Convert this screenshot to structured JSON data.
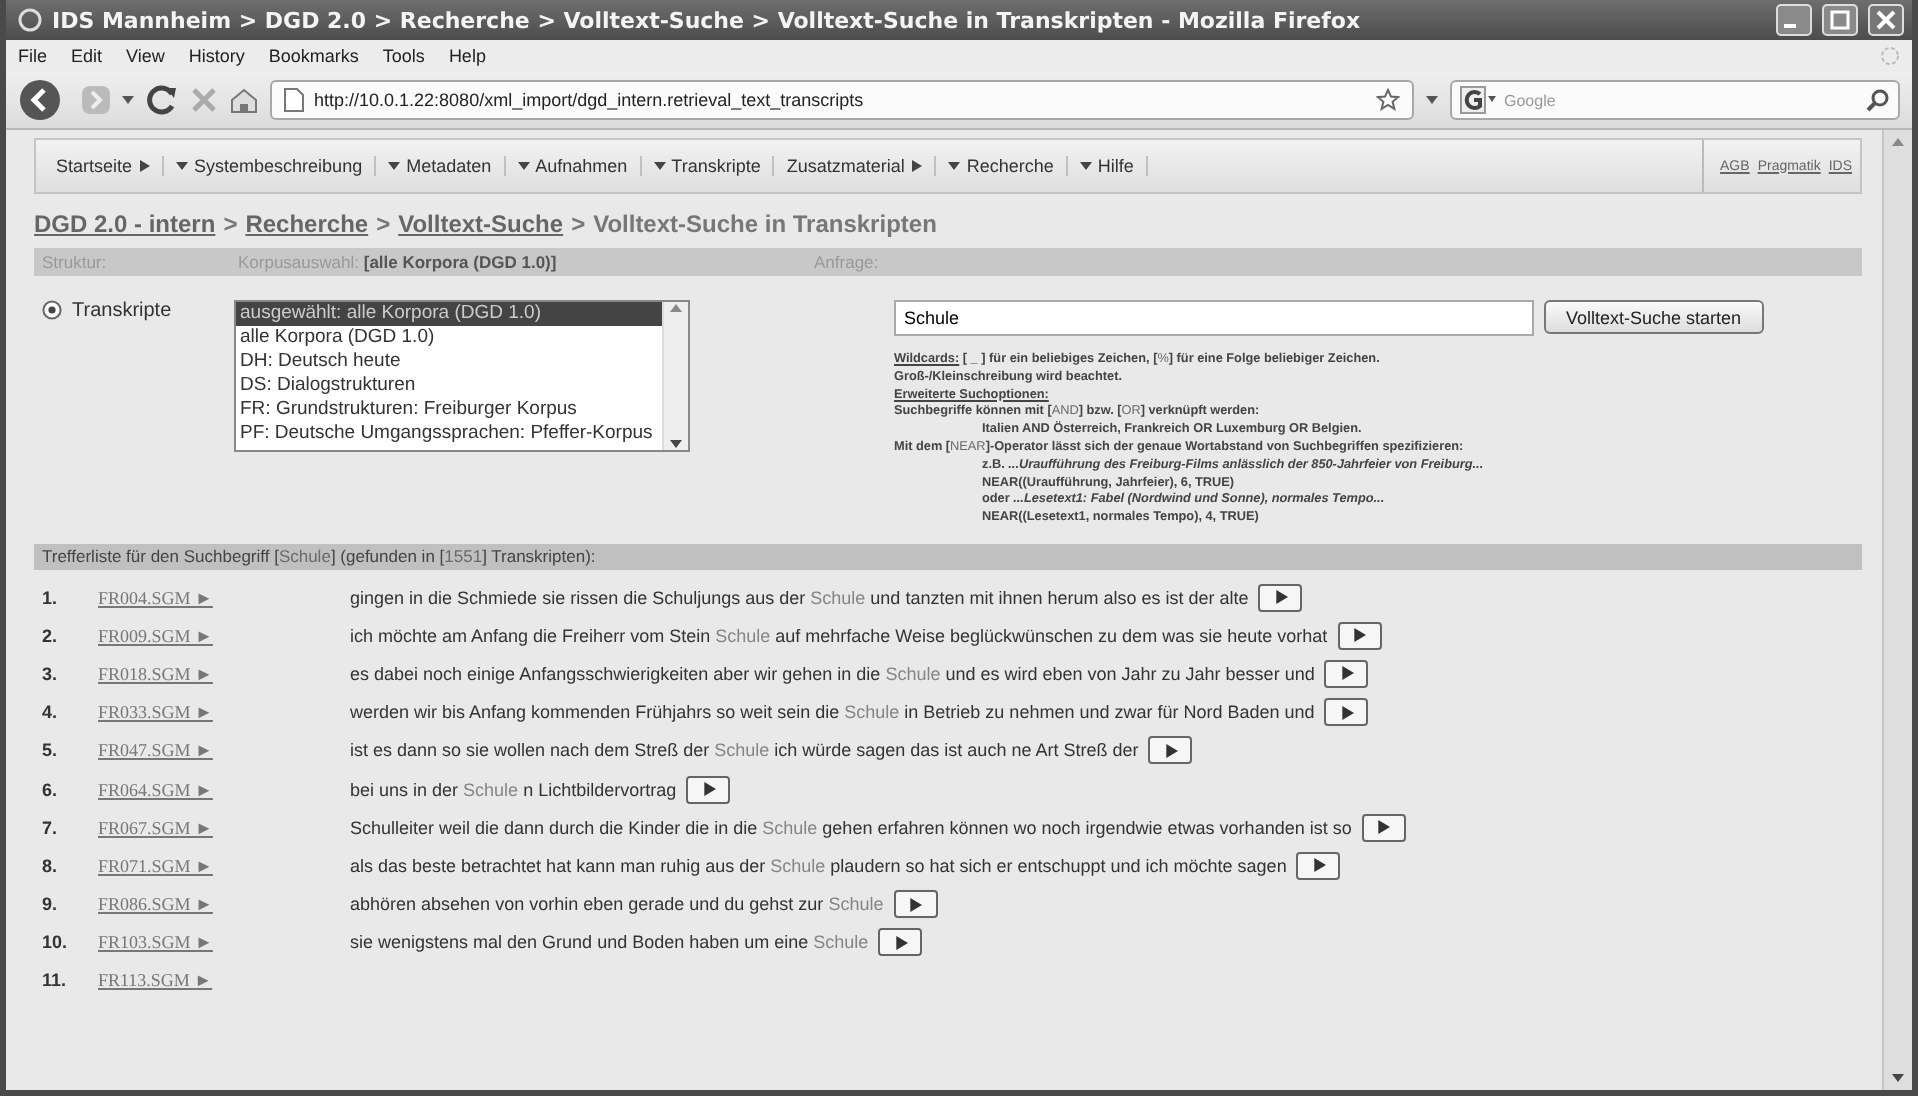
{
  "window": {
    "title": "IDS Mannheim > DGD 2.0 > Recherche > Volltext-Suche > Volltext-Suche in Transkripten - Mozilla Firefox"
  },
  "menu": [
    "File",
    "Edit",
    "View",
    "History",
    "Bookmarks",
    "Tools",
    "Help"
  ],
  "toolbar": {
    "url": "http://10.0.1.22:8080/xml_import/dgd_intern.retrieval_text_transcripts",
    "search_placeholder": "Google"
  },
  "site_nav": {
    "items": [
      {
        "label": "Startseite",
        "kind": "submenu"
      },
      {
        "label": "Systembeschreibung",
        "kind": "dropdown"
      },
      {
        "label": "Metadaten",
        "kind": "dropdown"
      },
      {
        "label": "Aufnahmen",
        "kind": "dropdown"
      },
      {
        "label": "Transkripte",
        "kind": "dropdown"
      },
      {
        "label": "Zusatzmaterial",
        "kind": "submenu"
      },
      {
        "label": "Recherche",
        "kind": "dropdown"
      },
      {
        "label": "Hilfe",
        "kind": "dropdown"
      }
    ],
    "links": [
      "AGB",
      "Pragmatik",
      "IDS"
    ]
  },
  "breadcrumb": {
    "separator": ">",
    "items": [
      {
        "label": "DGD 2.0 - intern",
        "kind": "link"
      },
      {
        "label": "Recherche",
        "kind": "link"
      },
      {
        "label": "Volltext-Suche",
        "kind": "link"
      },
      {
        "label": "Volltext-Suche in Transkripten",
        "kind": "current"
      }
    ]
  },
  "header": {
    "structure": "Struktur:",
    "corpus_label": "Korpusauswahl:",
    "corpus_value": "[alle Korpora (DGD 1.0)]",
    "query": "Anfrage:"
  },
  "structure_options": [
    {
      "label": "Transkripte",
      "selected": true
    }
  ],
  "corpus_list": [
    {
      "label": "ausgewählt: alle Korpora (DGD 1.0)",
      "selected": true
    },
    {
      "label": "alle Korpora (DGD 1.0)",
      "selected": false
    },
    {
      "label": "DH: Deutsch heute",
      "selected": false
    },
    {
      "label": "DS: Dialogstrukturen",
      "selected": false
    },
    {
      "label": "FR: Grundstrukturen: Freiburger Korpus",
      "selected": false
    },
    {
      "label": "PF: Deutsche Umgangssprachen: Pfeffer-Korpus",
      "selected": false
    }
  ],
  "query": {
    "value": "Schule",
    "button": "Volltext-Suche starten"
  },
  "help": [
    {
      "indent": false,
      "parts": [
        {
          "kind": "heading",
          "text": "Wildcards:"
        },
        {
          "kind": "plain",
          "text": " [ _ ] für ein beliebiges Zeichen, ["
        },
        {
          "kind": "hit",
          "text": "%"
        },
        {
          "kind": "plain",
          "text": "] für eine Folge beliebiger Zeichen."
        }
      ]
    },
    {
      "indent": false,
      "parts": [
        {
          "kind": "plain",
          "text": "Groß-/Kleinschreibung wird beachtet."
        }
      ]
    },
    {
      "indent": false,
      "parts": [
        {
          "kind": "heading",
          "text": "Erweiterte Suchoptionen:"
        }
      ]
    },
    {
      "indent": false,
      "parts": [
        {
          "kind": "plain",
          "text": "Suchbegriffe können mit ["
        },
        {
          "kind": "hit",
          "text": "AND"
        },
        {
          "kind": "plain",
          "text": "] bzw. ["
        },
        {
          "kind": "hit",
          "text": "OR"
        },
        {
          "kind": "plain",
          "text": "] verknüpft werden:"
        }
      ]
    },
    {
      "indent": true,
      "parts": [
        {
          "kind": "plain",
          "text": "Italien AND Österreich, Frankreich OR Luxemburg OR Belgien."
        }
      ]
    },
    {
      "indent": false,
      "parts": [
        {
          "kind": "plain",
          "text": "Mit dem ["
        },
        {
          "kind": "hit",
          "text": "NEAR"
        },
        {
          "kind": "plain",
          "text": "]-Operator lässt sich der genaue Wortabstand von Suchbegriffen spezifizieren:"
        }
      ]
    },
    {
      "indent": true,
      "parts": [
        {
          "kind": "plain",
          "text": "z.B. "
        },
        {
          "kind": "italic",
          "text": "...Uraufführung des Freiburg-Films anlässlich der 850-Jahrfeier von Freiburg..."
        }
      ]
    },
    {
      "indent": true,
      "parts": [
        {
          "kind": "plain",
          "text": "NEAR((Uraufführung, Jahrfeier), 6, TRUE)"
        }
      ]
    },
    {
      "indent": true,
      "parts": [
        {
          "kind": "plain",
          "text": "oder "
        },
        {
          "kind": "italic",
          "text": "...Lesetext1: Fabel (Nordwind und Sonne), normales Tempo..."
        }
      ]
    },
    {
      "indent": true,
      "parts": [
        {
          "kind": "plain",
          "text": "NEAR((Lesetext1, normales Tempo), 4, TRUE)"
        }
      ]
    }
  ],
  "results_heading": [
    {
      "kind": "plain",
      "text": "Trefferliste für den Suchbegriff ["
    },
    {
      "kind": "hit",
      "text": "Schule"
    },
    {
      "kind": "plain",
      "text": "] (gefunden in ["
    },
    {
      "kind": "hit",
      "text": "1551"
    },
    {
      "kind": "plain",
      "text": "] Transkripten):"
    }
  ],
  "results": [
    {
      "number": "1.",
      "file": "FR004.SGM ►",
      "before": "gingen in die Schmiede sie rissen die Schuljungs aus der ",
      "hit": "Schule",
      "after": " und tanzten mit ihnen herum also es ist der alte"
    },
    {
      "number": "2.",
      "file": "FR009.SGM ►",
      "before": "ich möchte am Anfang die Freiherr vom Stein ",
      "hit": "Schule",
      "after": " auf mehrfache Weise beglückwünschen zu dem was sie heute vorhat"
    },
    {
      "number": "3.",
      "file": "FR018.SGM ►",
      "before": "es dabei noch einige Anfangsschwierigkeiten aber wir gehen in die ",
      "hit": "Schule",
      "after": " und es wird eben von Jahr zu Jahr besser und"
    },
    {
      "number": "4.",
      "file": "FR033.SGM ►",
      "before": "werden wir bis Anfang kommenden Frühjahrs so weit sein die ",
      "hit": "Schule",
      "after": " in Betrieb zu nehmen und zwar für Nord Baden und"
    },
    {
      "number": "5.",
      "file": "FR047.SGM ►",
      "before": "ist es dann so sie wollen nach dem Streß der ",
      "hit": "Schule",
      "after": " ich würde sagen das ist auch ne Art Streß der"
    },
    {
      "number": "6.",
      "file": "FR064.SGM ►",
      "before": "bei uns in der ",
      "hit": "Schule",
      "after": " n Lichtbildervortrag"
    },
    {
      "number": "7.",
      "file": "FR067.SGM ►",
      "before": "Schulleiter weil die dann durch die Kinder die in die ",
      "hit": "Schule",
      "after": " gehen erfahren können wo noch irgendwie etwas vorhanden ist so"
    },
    {
      "number": "8.",
      "file": "FR071.SGM ►",
      "before": "als das beste betrachtet hat kann man ruhig aus der ",
      "hit": "Schule",
      "after": " plaudern so hat sich er entschuppt und ich möchte sagen"
    },
    {
      "number": "9.",
      "file": "FR086.SGM ►",
      "before": "abhören absehen von vorhin eben gerade und du gehst zur ",
      "hit": "Schule"
    },
    {
      "number": "10.",
      "file": "FR103.SGM ►",
      "before": "sie wenigstens mal den Grund und Boden haben um eine ",
      "hit": "Schule"
    },
    {
      "number": "11.",
      "file": "FR113.SGM ►"
    }
  ]
}
